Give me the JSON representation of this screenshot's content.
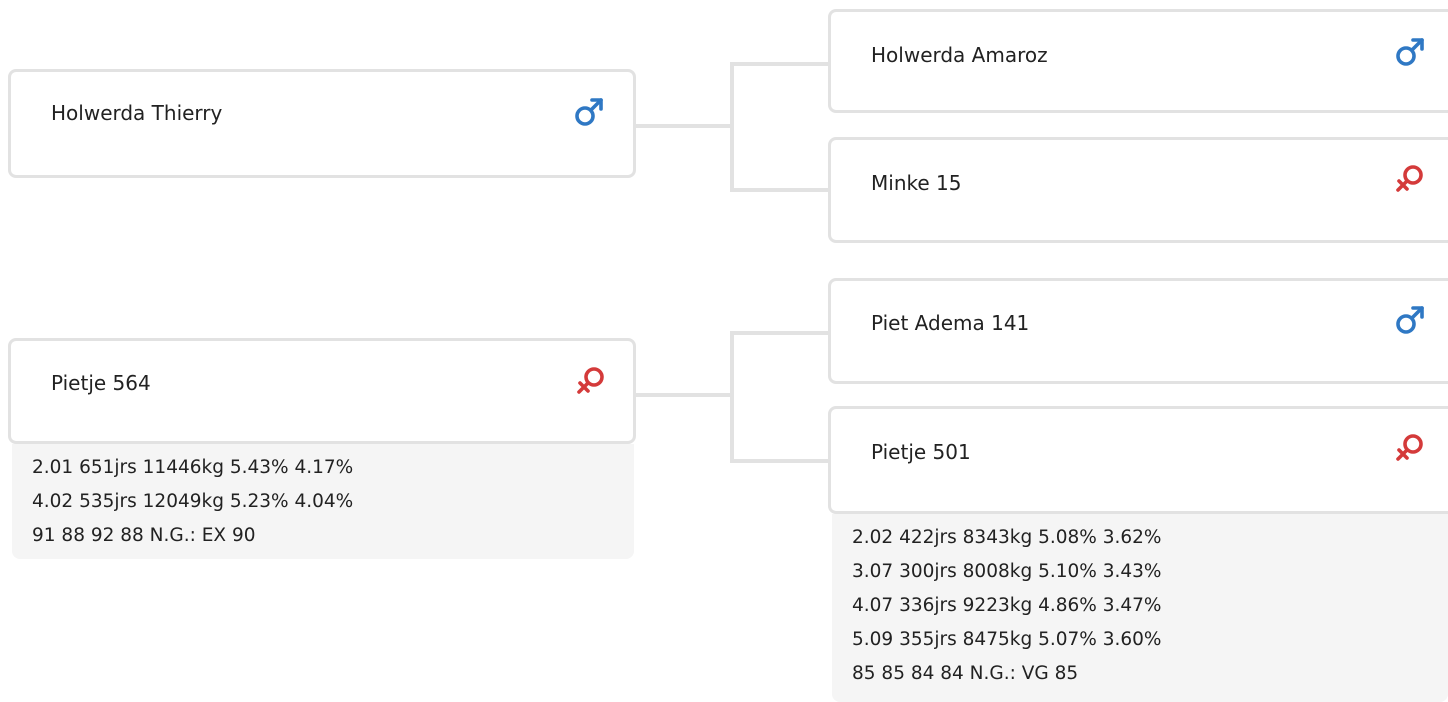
{
  "pedigree": {
    "parents": [
      {
        "name": "Holwerda Thierry",
        "sex": "male",
        "icon": "male-icon",
        "info": []
      },
      {
        "name": "Pietje 564",
        "sex": "female",
        "icon": "female-icon",
        "info": [
          "2.01 651jrs 11446kg 5.43% 4.17%",
          "4.02 535jrs 12049kg 5.23% 4.04%",
          "91 88 92 88 N.G.: EX 90"
        ]
      }
    ],
    "grandparents": [
      {
        "name": "Holwerda Amaroz",
        "sex": "male",
        "icon": "male-icon",
        "info": []
      },
      {
        "name": "Minke 15",
        "sex": "female",
        "icon": "female-icon",
        "info": []
      },
      {
        "name": "Piet Adema 141",
        "sex": "male",
        "icon": "male-icon",
        "info": []
      },
      {
        "name": "Pietje 501",
        "sex": "female",
        "icon": "female-icon",
        "info": [
          "2.02 422jrs 8343kg 5.08% 3.62%",
          "3.07 300jrs 8008kg 5.10% 3.43%",
          "4.07 336jrs 9223kg 4.86% 3.47%",
          "5.09 355jrs 8475kg 5.07% 3.60%",
          "85 85 84 84 N.G.: VG 85"
        ]
      }
    ]
  },
  "colors": {
    "male": "#2f78c4",
    "female": "#d43a3a",
    "card_border": "#e2e2e2",
    "info_bg": "#f5f5f5"
  }
}
